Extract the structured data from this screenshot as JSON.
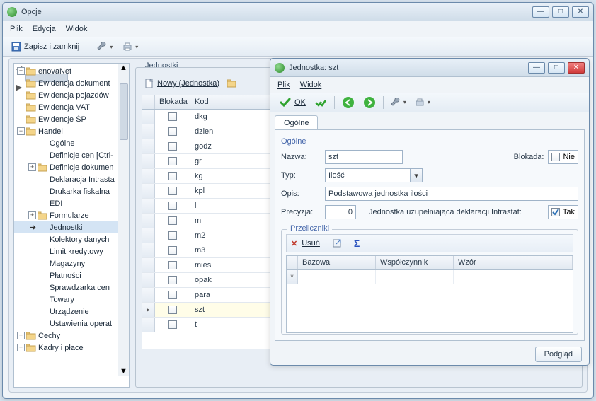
{
  "main_window": {
    "title": "Opcje",
    "menu": {
      "file": "Plik",
      "edit": "Edycja",
      "view": "Widok"
    },
    "toolbar": {
      "save_close": "Zapisz i zamknij"
    }
  },
  "tree": {
    "items": [
      {
        "label": "enovaNet",
        "level": 0,
        "exp": "+",
        "folder": true
      },
      {
        "label": "Ewidencja dokument",
        "level": 0,
        "exp": "",
        "folder": true
      },
      {
        "label": "Ewidencja pojazdów",
        "level": 0,
        "exp": "",
        "folder": true
      },
      {
        "label": "Ewidencja VAT",
        "level": 0,
        "exp": "",
        "folder": true
      },
      {
        "label": "Ewidencje ŚP",
        "level": 0,
        "exp": "",
        "folder": true
      },
      {
        "label": "Handel",
        "level": 0,
        "exp": "−",
        "folder": true
      },
      {
        "label": "Ogólne",
        "level": 1,
        "exp": "",
        "folder": false
      },
      {
        "label": "Definicje cen [Ctrl-",
        "level": 1,
        "exp": "",
        "folder": false
      },
      {
        "label": "Definicje dokumen",
        "level": 1,
        "exp": "+",
        "folder": true
      },
      {
        "label": "Deklaracja Intrasta",
        "level": 1,
        "exp": "",
        "folder": false
      },
      {
        "label": "Drukarka fiskalna",
        "level": 1,
        "exp": "",
        "folder": false
      },
      {
        "label": "EDI",
        "level": 1,
        "exp": "",
        "folder": false
      },
      {
        "label": "Formularze",
        "level": 1,
        "exp": "+",
        "folder": true
      },
      {
        "label": "Jednostki",
        "level": 1,
        "exp": "",
        "folder": false,
        "arrow": true,
        "selected": true
      },
      {
        "label": "Kolektory danych",
        "level": 1,
        "exp": "",
        "folder": false
      },
      {
        "label": "Limit kredytowy",
        "level": 1,
        "exp": "",
        "folder": false
      },
      {
        "label": "Magazyny",
        "level": 1,
        "exp": "",
        "folder": false
      },
      {
        "label": "Płatności",
        "level": 1,
        "exp": "",
        "folder": false
      },
      {
        "label": "Sprawdzarka cen",
        "level": 1,
        "exp": "",
        "folder": false
      },
      {
        "label": "Towary",
        "level": 1,
        "exp": "",
        "folder": false
      },
      {
        "label": "Urządzenie",
        "level": 1,
        "exp": "",
        "folder": false
      },
      {
        "label": "Ustawienia operat",
        "level": 1,
        "exp": "",
        "folder": false
      },
      {
        "label": "Cechy",
        "level": 0,
        "exp": "+",
        "folder": true
      },
      {
        "label": "Kadry i płace",
        "level": 0,
        "exp": "+",
        "folder": true
      }
    ]
  },
  "list": {
    "legend": "Jednostki",
    "new_label": "Nowy (Jednostka)",
    "columns": {
      "blokada": "Blokada",
      "kod": "Kod"
    },
    "rows": [
      {
        "kod": "dkg"
      },
      {
        "kod": "dzien"
      },
      {
        "kod": "godz"
      },
      {
        "kod": "gr"
      },
      {
        "kod": "kg"
      },
      {
        "kod": "kpl"
      },
      {
        "kod": "l"
      },
      {
        "kod": "m"
      },
      {
        "kod": "m2"
      },
      {
        "kod": "m3"
      },
      {
        "kod": "mies"
      },
      {
        "kod": "opak"
      },
      {
        "kod": "para"
      },
      {
        "kod": "szt",
        "selected": true
      },
      {
        "kod": "t"
      }
    ]
  },
  "dialog": {
    "title": "Jednostka: szt",
    "menu": {
      "file": "Plik",
      "view": "Widok"
    },
    "ok_label": "OK",
    "tab_label": "Ogólne",
    "group1": "Ogólne",
    "fields": {
      "nazwa_label": "Nazwa:",
      "nazwa_value": "szt",
      "blokada_label": "Blokada:",
      "blokada_value": "Nie",
      "typ_label": "Typ:",
      "typ_value": "Ilość",
      "opis_label": "Opis:",
      "opis_value": "Podstawowa jednostka ilości",
      "precyzja_label": "Precyzja:",
      "precyzja_value": "0",
      "intrastat_label": "Jednostka uzupełniająca deklaracji Intrastat:",
      "intrastat_value": "Tak"
    },
    "group2": "Przeliczniki",
    "sub_toolbar": {
      "delete": "Usuń"
    },
    "sub_columns": {
      "bazowa": "Bazowa",
      "wsp": "Współczynnik",
      "wzor": "Wzór"
    },
    "footer_btn": "Podgląd"
  }
}
